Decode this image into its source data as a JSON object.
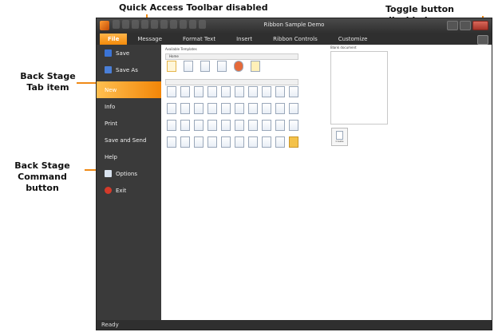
{
  "annotations": {
    "qat": "Quick Access Toolbar disabled",
    "toggle": "Toggle button disabled",
    "backstage_tab_1": "Back Stage",
    "backstage_tab_2": "Tab item",
    "backstage_cmd_1": "Back Stage",
    "backstage_cmd_2": "Command button"
  },
  "window": {
    "title": "Ribbon Sample Demo"
  },
  "ribbon": {
    "tabs": [
      "File",
      "Message",
      "Format Text",
      "Insert",
      "Ribbon Controls",
      "Customize"
    ]
  },
  "backstage": {
    "items": [
      {
        "label": "Save",
        "icon": "save-icon",
        "color": "#3b74d6"
      },
      {
        "label": "Save As",
        "icon": "save-as-icon",
        "color": "#4a7fd8"
      },
      {
        "label": "New",
        "icon": "",
        "color": ""
      },
      {
        "label": "Info",
        "icon": "",
        "color": ""
      },
      {
        "label": "Print",
        "icon": "",
        "color": ""
      },
      {
        "label": "Save and Send",
        "icon": "",
        "color": ""
      },
      {
        "label": "Help",
        "icon": "",
        "color": ""
      },
      {
        "label": "Options",
        "icon": "options-icon",
        "color": "#d9e3ef"
      },
      {
        "label": "Exit",
        "icon": "exit-icon",
        "color": "#d43a2a"
      }
    ],
    "selected": "New"
  },
  "content": {
    "templates_title": "Available Templates",
    "nav_label": "Home",
    "preview_label": "Blank document",
    "create_label": "Create"
  },
  "status": {
    "text": "Ready"
  },
  "colors": {
    "accent": "#f28608",
    "annotation_arrow": "#f08a16"
  }
}
